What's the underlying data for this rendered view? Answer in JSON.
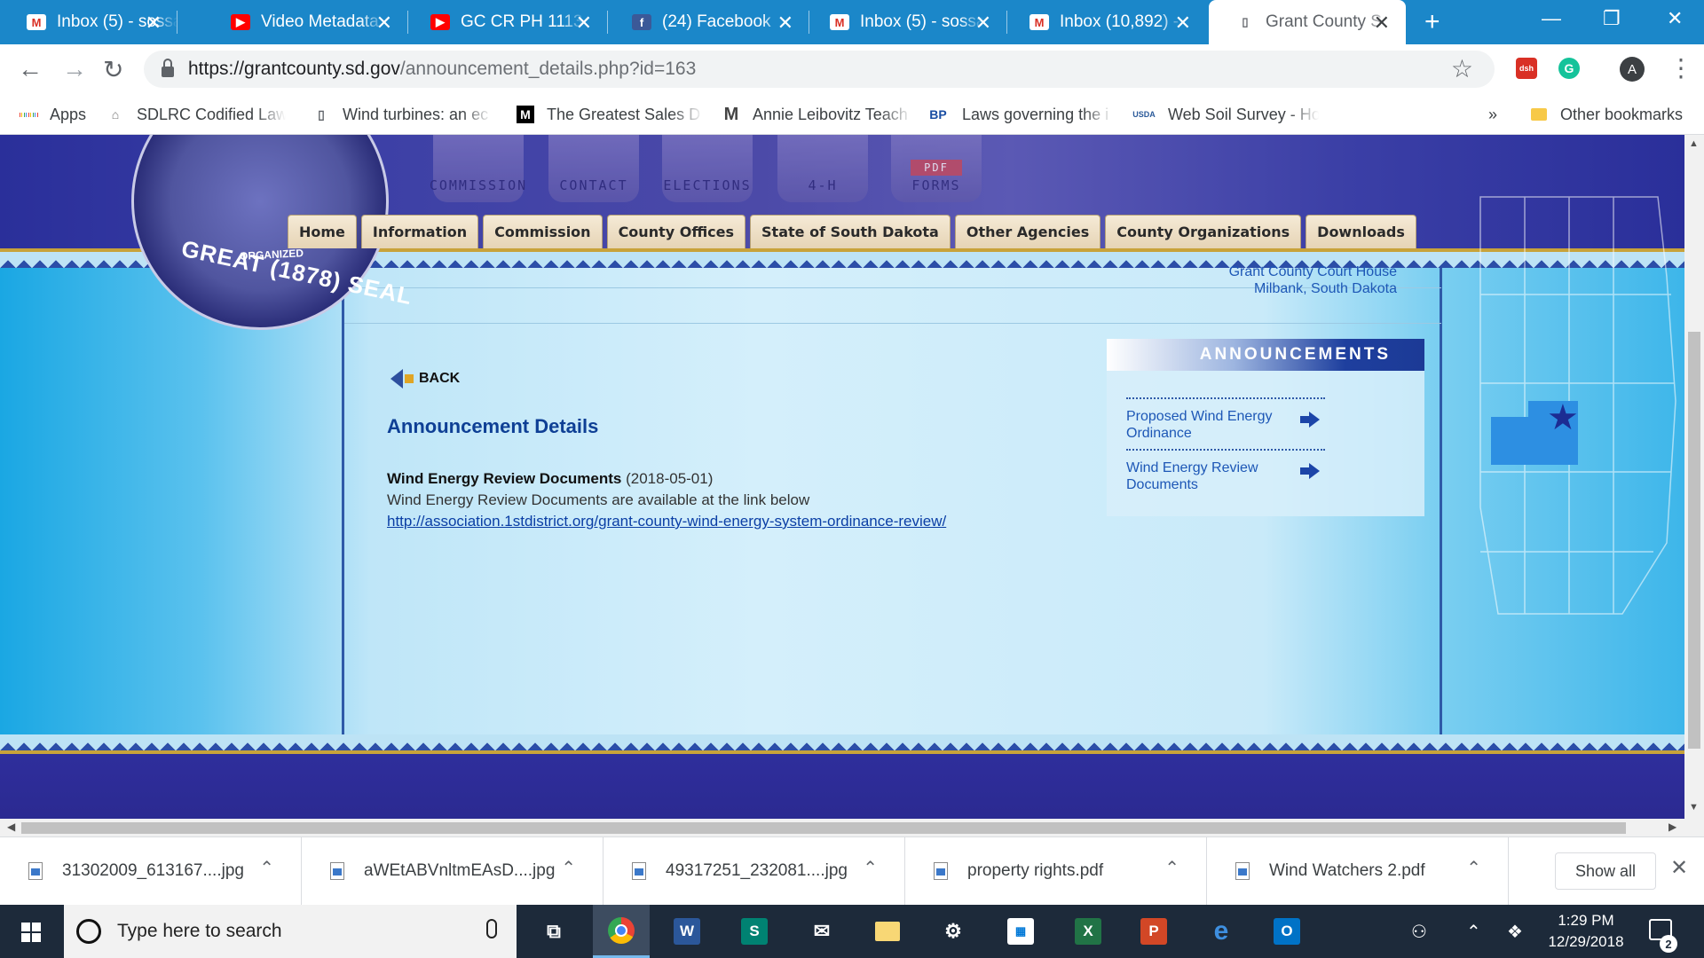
{
  "browser": {
    "tabs": [
      {
        "title": "Inbox (5) - sossa",
        "favicon": "gmail-icon",
        "color": "#d93025",
        "active": false
      },
      {
        "title": "Video Metadata",
        "favicon": "youtube-icon",
        "color": "#ff0000",
        "active": false
      },
      {
        "title": "GC CR PH 1113",
        "favicon": "youtube-icon",
        "color": "#ff0000",
        "active": false
      },
      {
        "title": "(24) Facebook",
        "favicon": "facebook-icon",
        "color": "#3b5998",
        "active": false
      },
      {
        "title": "Inbox (5) - sossa",
        "favicon": "gmail-icon",
        "color": "#d93025",
        "active": false
      },
      {
        "title": "Inbox (10,892) -",
        "favicon": "gmail-icon",
        "color": "#d93025",
        "active": false
      },
      {
        "title": "Grant County S",
        "favicon": "page-icon",
        "color": "#5f6368",
        "active": true
      }
    ],
    "url": {
      "host": "https://grantcounty.sd.gov",
      "path": "/announcement_details.php?id=163"
    },
    "profile_initial": "A",
    "bookmarks": [
      {
        "label": "Apps",
        "icon": "apps-grid-icon"
      },
      {
        "label": "SDLRC Codified Laws",
        "icon": "capitol-icon"
      },
      {
        "label": "Wind turbines: an ec",
        "icon": "page-icon"
      },
      {
        "label": "The Greatest Sales D",
        "icon": "medium-icon"
      },
      {
        "label": "Annie Leibovitz Teach",
        "icon": "masterclass-icon"
      },
      {
        "label": "Laws governing the i",
        "icon": "bp-icon"
      },
      {
        "label": "Web Soil Survey - Ho",
        "icon": "usda-icon"
      }
    ],
    "overflow_label": "»",
    "other_bookmarks": "Other bookmarks"
  },
  "site": {
    "header_buttons": [
      "COMMISSION",
      "CONTACT",
      "ELECTIONS",
      "4-H",
      "FORMS"
    ],
    "header_pdf_label": "PDF",
    "seal": {
      "arc_text": "GREAT (1878) SEAL",
      "organized": "ORGANIZED"
    },
    "nav": [
      "Home",
      "Information",
      "Commission",
      "County Offices",
      "State of South Dakota",
      "Other Agencies",
      "County Organizations",
      "Downloads"
    ],
    "location": {
      "line1": "Grant County Court House",
      "line2": "Milbank, South Dakota"
    },
    "back_label": "BACK",
    "page_title": "Announcement Details",
    "announcement": {
      "title": "Wind Energy Review Documents",
      "date": "(2018-05-01)",
      "body": "Wind Energy Review Documents are available at the link below",
      "link": "http://association.1stdistrict.org/grant-county-wind-energy-system-ordinance-review/"
    },
    "sidebar": {
      "heading": "ANNOUNCEMENTS",
      "items": [
        "Proposed Wind Energy Ordinance",
        "Wind Energy Review Documents"
      ]
    }
  },
  "downloads": {
    "items": [
      "31302009_613167....jpg",
      "aWEtABVnltmEAsD....jpg",
      "49317251_232081....jpg",
      "property rights.pdf",
      "Wind Watchers 2.pdf"
    ],
    "show_all": "Show all"
  },
  "taskbar": {
    "search_placeholder": "Type here to search",
    "time": "1:29 PM",
    "date": "12/29/2018",
    "notification_count": "2"
  }
}
